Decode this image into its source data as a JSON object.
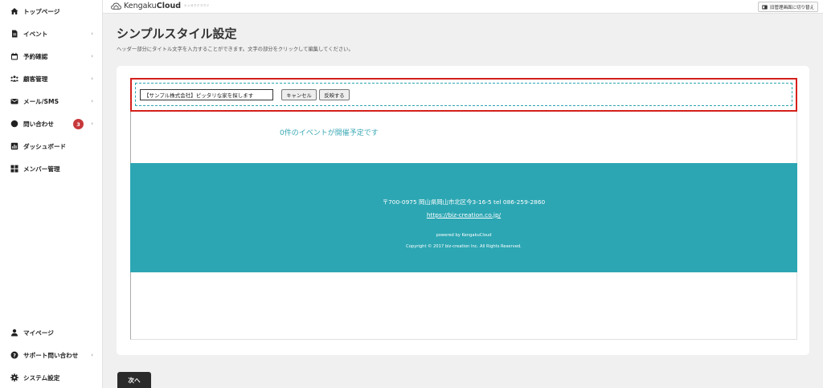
{
  "sidebar": {
    "items": [
      {
        "label": "トップページ",
        "icon": "home-icon",
        "chevron": false
      },
      {
        "label": "イベント",
        "icon": "document-icon",
        "chevron": true
      },
      {
        "label": "予約確認",
        "icon": "calendar-icon",
        "chevron": true
      },
      {
        "label": "顧客管理",
        "icon": "people-icon",
        "chevron": true
      },
      {
        "label": "メール/SMS",
        "icon": "mail-icon",
        "chevron": true
      },
      {
        "label": "問い合わせ",
        "icon": "chat-icon",
        "chevron": true,
        "badge": "3"
      },
      {
        "label": "ダッシュボード",
        "icon": "chart-icon",
        "chevron": false
      },
      {
        "label": "メンバー管理",
        "icon": "grid-icon",
        "chevron": false
      }
    ],
    "bottom_items": [
      {
        "label": "マイページ",
        "icon": "user-icon",
        "chevron": false
      },
      {
        "label": "サポート問い合わせ",
        "icon": "help-icon",
        "chevron": true
      },
      {
        "label": "システム設定",
        "icon": "gear-icon",
        "chevron": false
      }
    ],
    "chevron_glyph": "›"
  },
  "topbar": {
    "logo_regular": "Kengaku",
    "logo_bold": "Cloud",
    "logo_sub": "ケンガククラウド",
    "switch_label": "旧管理画面に切り替え"
  },
  "page": {
    "title": "シンプルスタイル設定",
    "description": "ヘッダー部分にタイトル文字を入力することができます。文字の部分をクリックして編集してください。"
  },
  "editor": {
    "title_value": "【サンプル株式会社】ピッタリな家を探します",
    "cancel_label": "キャンセル",
    "apply_label": "反映する"
  },
  "preview": {
    "events_message": "0件のイベントが開催予定です",
    "footer_address": "〒700-0975 岡山県岡山市北区今3-16-5 tel 086-259-2860",
    "footer_url": "https://biz-creation.co.jp/",
    "powered_by": "powered by KengakuCloud",
    "copyright": "Copyright © 2017 biz-creation Inc. All Rights Reserved."
  },
  "actions": {
    "next_label": "次へ"
  },
  "colors": {
    "accent": "#2ca6b3",
    "highlight_border": "#d4201c",
    "badge": "#c7383b"
  }
}
